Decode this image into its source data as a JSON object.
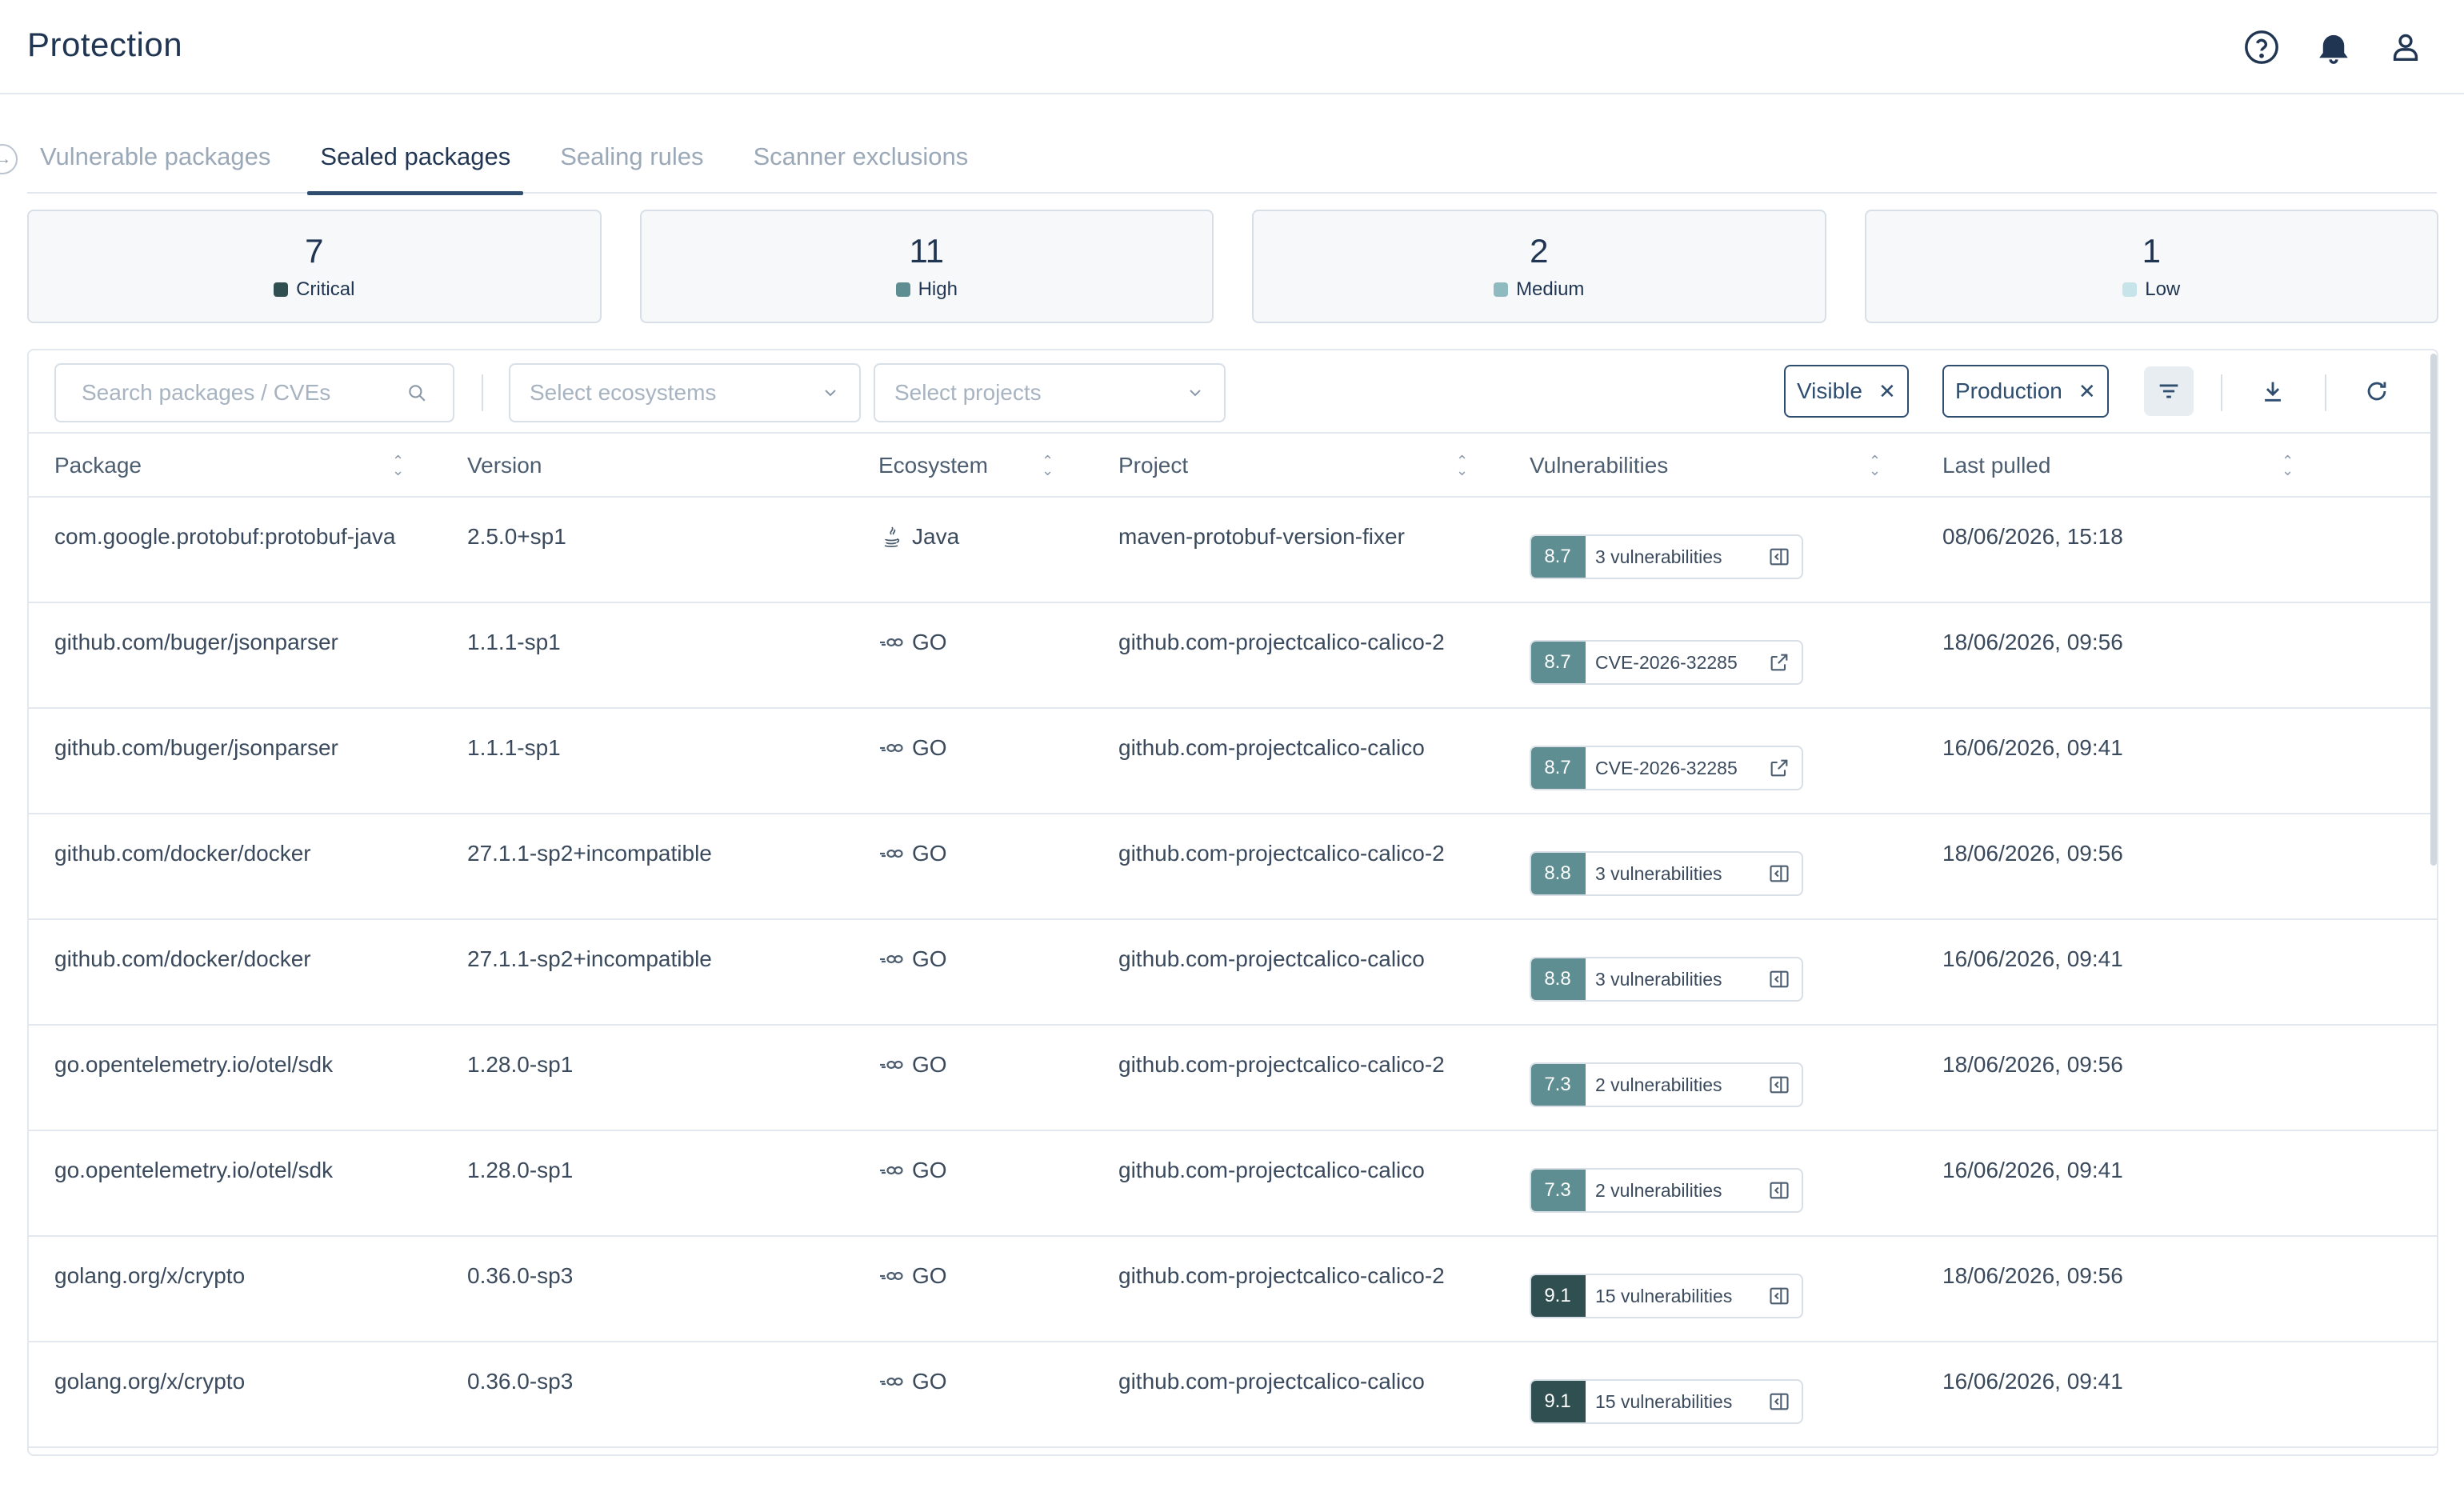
{
  "header": {
    "title": "Protection",
    "icons": [
      "help-circle-icon",
      "bell-icon",
      "user-icon"
    ]
  },
  "tabs": [
    {
      "label": "Vulnerable packages",
      "active": false
    },
    {
      "label": "Sealed packages",
      "active": true
    },
    {
      "label": "Sealing rules",
      "active": false
    },
    {
      "label": "Scanner exclusions",
      "active": false
    }
  ],
  "summary": [
    {
      "count": "7",
      "label": "Critical",
      "color": "#2f4f50"
    },
    {
      "count": "11",
      "label": "High",
      "color": "#5e8e91"
    },
    {
      "count": "2",
      "label": "Medium",
      "color": "#8fbac0"
    },
    {
      "count": "1",
      "label": "Low",
      "color": "#c7e4ea"
    }
  ],
  "toolbar": {
    "search_placeholder": "Search packages / CVEs",
    "ecosystems_placeholder": "Select ecosystems",
    "projects_placeholder": "Select projects",
    "chips": [
      "Visible",
      "Production"
    ],
    "icons": [
      "filter-icon",
      "download-icon",
      "refresh-icon"
    ]
  },
  "columns": [
    "Package",
    "Version",
    "Ecosystem",
    "Project",
    "Vulnerabilities",
    "Last pulled"
  ],
  "colors": {
    "score_critical": "#2f4f50",
    "score_high": "#5e8e91"
  },
  "rows": [
    {
      "package": "com.google.protobuf:protobuf-java",
      "version": "2.5.0+sp1",
      "ecosystem": "Java",
      "eco_icon": "java-icon",
      "project": "maven-protobuf-version-fixer",
      "score": "8.7",
      "vuln": "3 vulnerabilities",
      "vuln_icon": "side-panel-icon",
      "date": "08/06/2026, 15:18"
    },
    {
      "package": "github.com/buger/jsonparser",
      "version": "1.1.1-sp1",
      "ecosystem": "GO",
      "eco_icon": "go-icon",
      "project": "github.com-projectcalico-calico-2",
      "score": "8.7",
      "vuln": "CVE-2026-32285",
      "vuln_icon": "external-link-icon",
      "date": "18/06/2026, 09:56"
    },
    {
      "package": "github.com/buger/jsonparser",
      "version": "1.1.1-sp1",
      "ecosystem": "GO",
      "eco_icon": "go-icon",
      "project": "github.com-projectcalico-calico",
      "score": "8.7",
      "vuln": "CVE-2026-32285",
      "vuln_icon": "external-link-icon",
      "date": "16/06/2026, 09:41"
    },
    {
      "package": "github.com/docker/docker",
      "version": "27.1.1-sp2+incompatible",
      "ecosystem": "GO",
      "eco_icon": "go-icon",
      "project": "github.com-projectcalico-calico-2",
      "score": "8.8",
      "vuln": "3 vulnerabilities",
      "vuln_icon": "side-panel-icon",
      "date": "18/06/2026, 09:56"
    },
    {
      "package": "github.com/docker/docker",
      "version": "27.1.1-sp2+incompatible",
      "ecosystem": "GO",
      "eco_icon": "go-icon",
      "project": "github.com-projectcalico-calico",
      "score": "8.8",
      "vuln": "3 vulnerabilities",
      "vuln_icon": "side-panel-icon",
      "date": "16/06/2026, 09:41"
    },
    {
      "package": "go.opentelemetry.io/otel/sdk",
      "version": "1.28.0-sp1",
      "ecosystem": "GO",
      "eco_icon": "go-icon",
      "project": "github.com-projectcalico-calico-2",
      "score": "7.3",
      "vuln": "2 vulnerabilities",
      "vuln_icon": "side-panel-icon",
      "date": "18/06/2026, 09:56"
    },
    {
      "package": "go.opentelemetry.io/otel/sdk",
      "version": "1.28.0-sp1",
      "ecosystem": "GO",
      "eco_icon": "go-icon",
      "project": "github.com-projectcalico-calico",
      "score": "7.3",
      "vuln": "2 vulnerabilities",
      "vuln_icon": "side-panel-icon",
      "date": "16/06/2026, 09:41"
    },
    {
      "package": "golang.org/x/crypto",
      "version": "0.36.0-sp3",
      "ecosystem": "GO",
      "eco_icon": "go-icon",
      "project": "github.com-projectcalico-calico-2",
      "score": "9.1",
      "vuln": "15 vulnerabilities",
      "vuln_icon": "side-panel-icon",
      "date": "18/06/2026, 09:56"
    },
    {
      "package": "golang.org/x/crypto",
      "version": "0.36.0-sp3",
      "ecosystem": "GO",
      "eco_icon": "go-icon",
      "project": "github.com-projectcalico-calico",
      "score": "9.1",
      "vuln": "15 vulnerabilities",
      "vuln_icon": "side-panel-icon",
      "date": "16/06/2026, 09:41"
    }
  ]
}
